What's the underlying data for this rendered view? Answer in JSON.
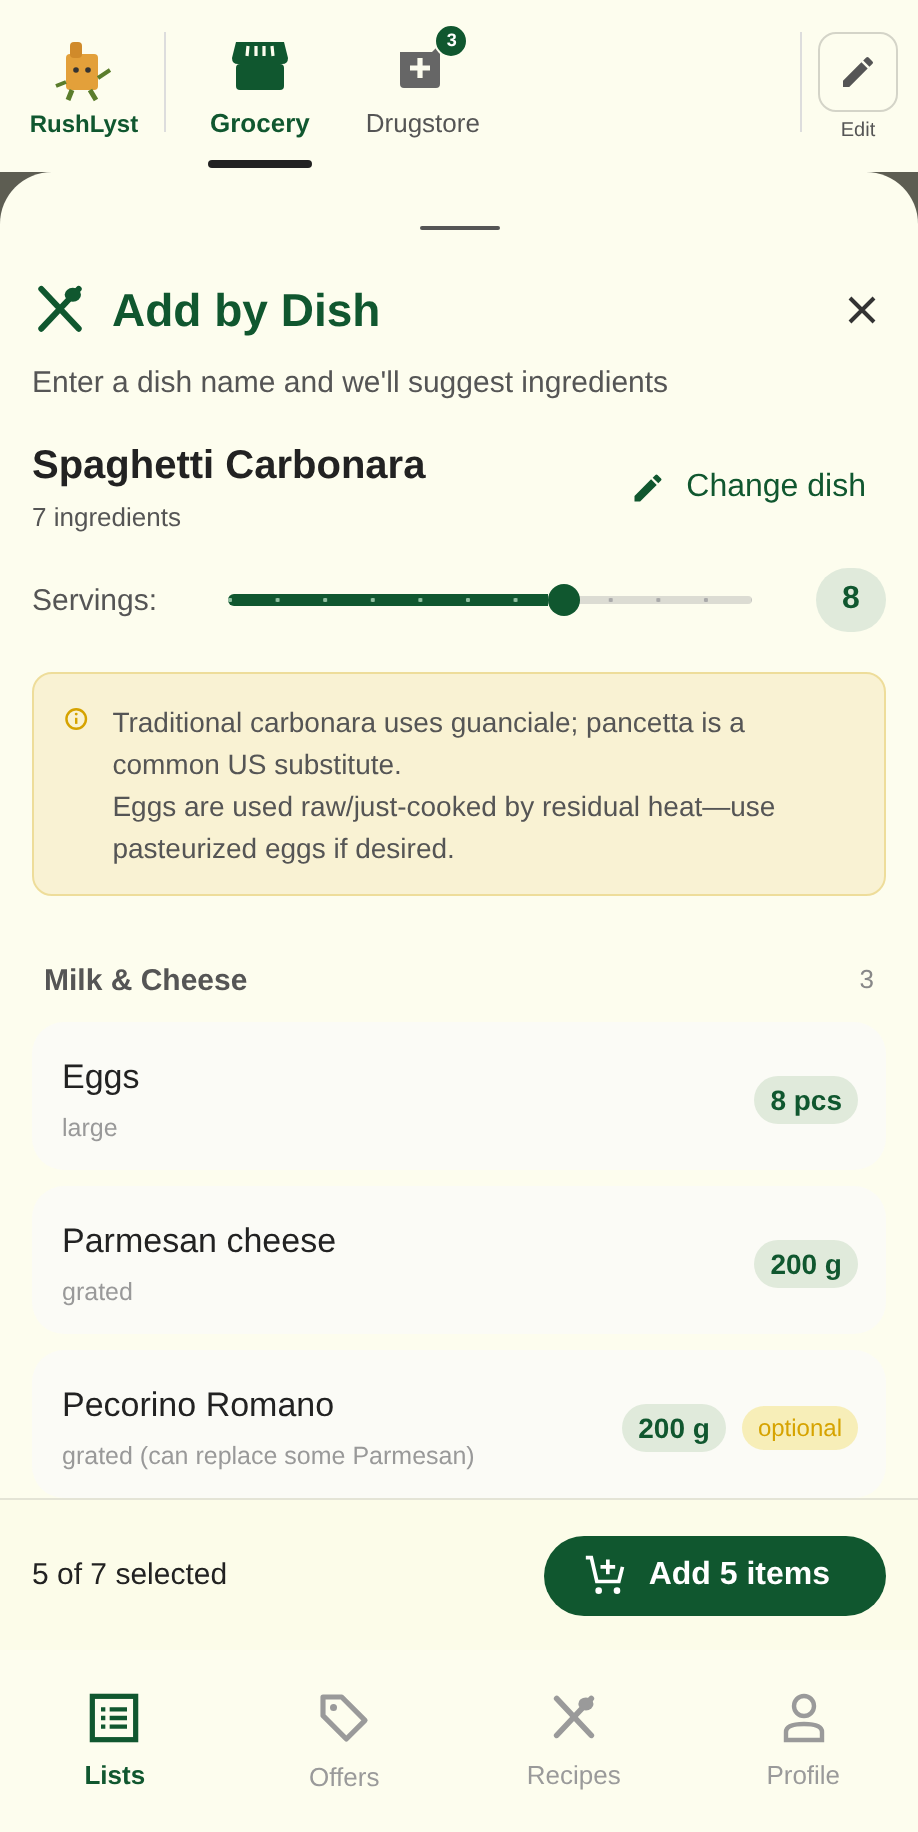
{
  "header": {
    "brand": "RushLyst",
    "tabs": [
      {
        "label": "Grocery",
        "selected": true,
        "kind": "store"
      },
      {
        "label": "Drugstore",
        "selected": false,
        "kind": "pharmacy",
        "badge": "3"
      }
    ],
    "edit": "Edit"
  },
  "sheet": {
    "title": "Add by Dish",
    "subtitle": "Enter a dish name and we'll suggest ingredients",
    "dish": {
      "name": "Spaghetti Carbonara",
      "count": "7 ingredients",
      "change": "Change dish"
    },
    "servings": {
      "label": "Servings:",
      "level": 0.64,
      "value": "8"
    },
    "note": {
      "lines": [
        "Traditional carbonara uses guanciale; pancetta is a common US substitute.",
        "Eggs are used raw/just-cooked by residual heat—use pasteurized eggs if desired."
      ]
    },
    "section": {
      "title": "Milk & Cheese",
      "count": "3"
    },
    "items": [
      {
        "name": "Eggs",
        "detail": "large",
        "qty": "8 pcs",
        "optional": false
      },
      {
        "name": "Parmesan cheese",
        "detail": "grated",
        "qty": "200 g",
        "optional": false
      },
      {
        "name": "Pecorino Romano",
        "detail": "grated (can replace some Parmesan)",
        "qty": "200 g",
        "optional": true,
        "optional_label": "optional"
      }
    ]
  },
  "action": {
    "summary": "5 of 7 selected",
    "button": "Add 5 items"
  },
  "nav": [
    {
      "label": "Lists",
      "selected": true,
      "kind": "list"
    },
    {
      "label": "Offers",
      "selected": false,
      "kind": "tag"
    },
    {
      "label": "Recipes",
      "selected": false,
      "kind": "cutlery"
    },
    {
      "label": "Profile",
      "selected": false,
      "kind": "person"
    }
  ]
}
